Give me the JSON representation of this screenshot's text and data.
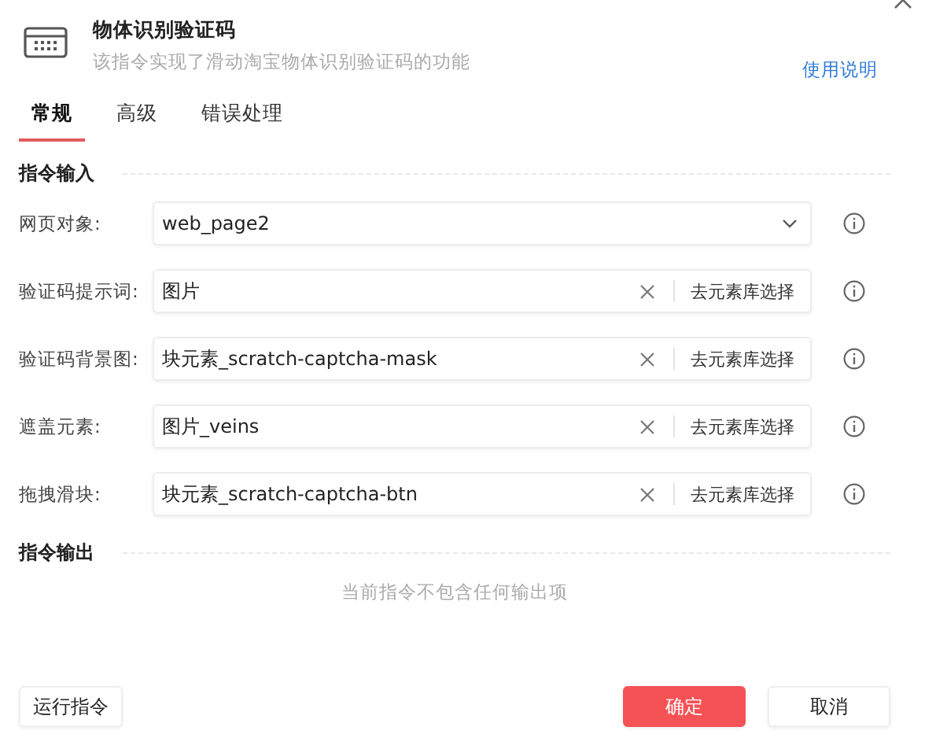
{
  "header": {
    "title": "物体识别验证码",
    "description": "该指令实现了滑动淘宝物体识别验证码的功能",
    "help_link": "使用说明"
  },
  "tabs": [
    {
      "label": "常规",
      "selected": true
    },
    {
      "label": "高级",
      "selected": false
    },
    {
      "label": "错误处理",
      "selected": false
    }
  ],
  "input_section": {
    "title": "指令输入",
    "fields": [
      {
        "kind": "select",
        "label": "网页对象:",
        "value": "web_page2"
      },
      {
        "kind": "element",
        "label": "验证码提示词:",
        "value": "图片",
        "action": "去元素库选择"
      },
      {
        "kind": "element",
        "label": "验证码背景图:",
        "value": "块元素_scratch-captcha-mask",
        "action": "去元素库选择"
      },
      {
        "kind": "element",
        "label": "遮盖元素:",
        "value": "图片_veins",
        "action": "去元素库选择"
      },
      {
        "kind": "element",
        "label": "拖拽滑块:",
        "value": "块元素_scratch-captcha-btn",
        "action": "去元素库选择"
      }
    ]
  },
  "output_section": {
    "title": "指令输出",
    "empty_text": "当前指令不包含任何输出项"
  },
  "footer": {
    "run_button": "运行指令",
    "confirm_button": "确定",
    "cancel_button": "取消"
  }
}
